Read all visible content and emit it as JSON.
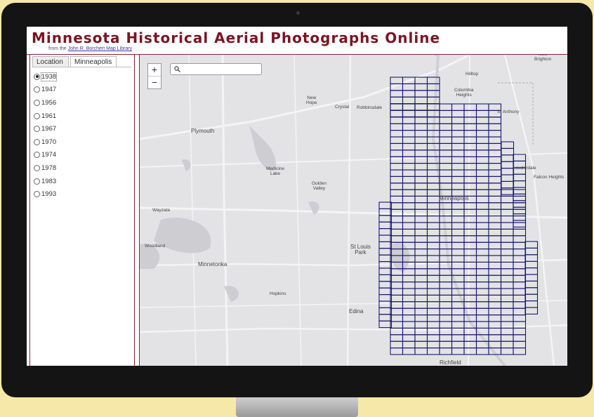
{
  "app": {
    "title": "Minnesota Historical Aerial Photographs Online",
    "subtitle_prefix": "from the",
    "subtitle_link": "John R. Borchert Map Library"
  },
  "sidebar": {
    "tabs": [
      {
        "label": "Location"
      },
      {
        "label": "Minneapolis"
      }
    ],
    "selected_year": "1938",
    "years": [
      {
        "label": "1938"
      },
      {
        "label": "1947"
      },
      {
        "label": "1956"
      },
      {
        "label": "1961"
      },
      {
        "label": "1967"
      },
      {
        "label": "1970"
      },
      {
        "label": "1974"
      },
      {
        "label": "1978"
      },
      {
        "label": "1983"
      },
      {
        "label": "1993"
      }
    ]
  },
  "map": {
    "zoom_in": "+",
    "zoom_out": "−",
    "search_placeholder": "",
    "search_icon": "search-icon",
    "grid_color": "#1a1a6e",
    "places": {
      "new_brighton": "New\nBrighton",
      "hilltop": "Hilltop",
      "columbia_heights": "Columbia\nHeights",
      "new_hope": "New\nHope",
      "crystal": "Crystal",
      "robbinsdale": "Robbinsdale",
      "st_anthony": "St Anthony",
      "plymouth": "Plymouth",
      "medicine_lake": "Medicine\nLake",
      "golden_valley": "Golden\nValley",
      "lauderdale": "Lauderdale",
      "falcon_heights": "Falcon Heights",
      "minneapolis": "Minneapolis",
      "wayzata": "Wayzata",
      "woodland": "Woodland",
      "st_louis_park": "St Louis\nPark",
      "minnetonka": "Minnetonka",
      "hopkins": "Hopkins",
      "edina": "Edina",
      "richfield": "Richfield"
    }
  }
}
